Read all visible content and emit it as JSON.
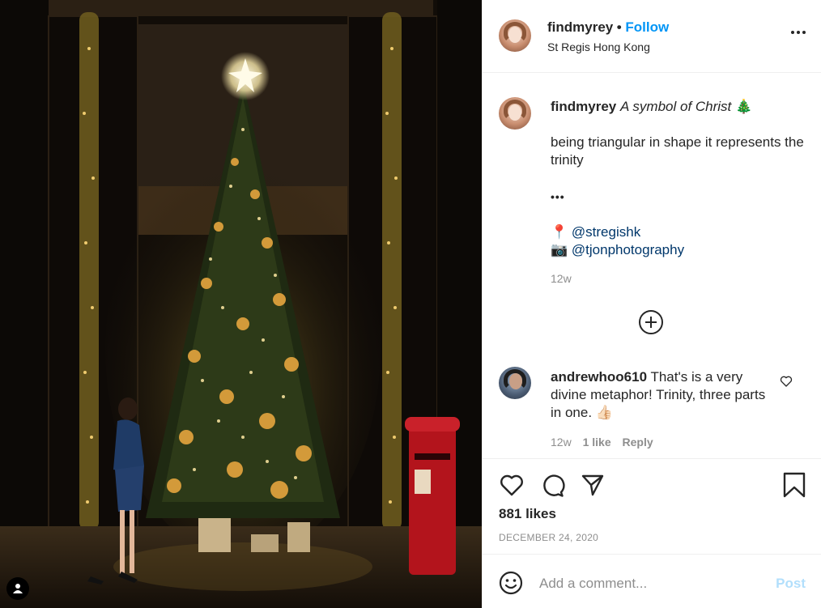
{
  "post": {
    "username": "findmyrey",
    "follow_label": "Follow",
    "location": "St Regis Hong Kong",
    "caption_title": "A symbol of Christ",
    "caption_emoji": "🎄",
    "caption_body": "being triangular in shape it represents the trinity",
    "caption_ellipsis": "•••",
    "mention_1_emoji": "📍",
    "mention_1": "@stregishk",
    "mention_2_emoji": "📷",
    "mention_2": "@tjonphotography",
    "caption_time": "12w"
  },
  "comment": {
    "username": "andrewhoo610",
    "text": "That's is a very divine metaphor! Trinity, three parts in one.",
    "emoji": "👍🏻",
    "time": "12w",
    "likes": "1 like",
    "reply_label": "Reply"
  },
  "stats": {
    "likes": "881 likes",
    "date": "DECEMBER 24, 2020"
  },
  "composer": {
    "placeholder": "Add a comment...",
    "post_label": "Post"
  },
  "colors": {
    "accent": "#0095f6",
    "post_disabled": "#b2dffc",
    "mention": "#00376b"
  },
  "icons": [
    "user-tag-icon",
    "more-options-icon",
    "add-circle-icon",
    "heart-icon",
    "comment-icon",
    "share-icon",
    "bookmark-icon",
    "emoji-icon"
  ]
}
